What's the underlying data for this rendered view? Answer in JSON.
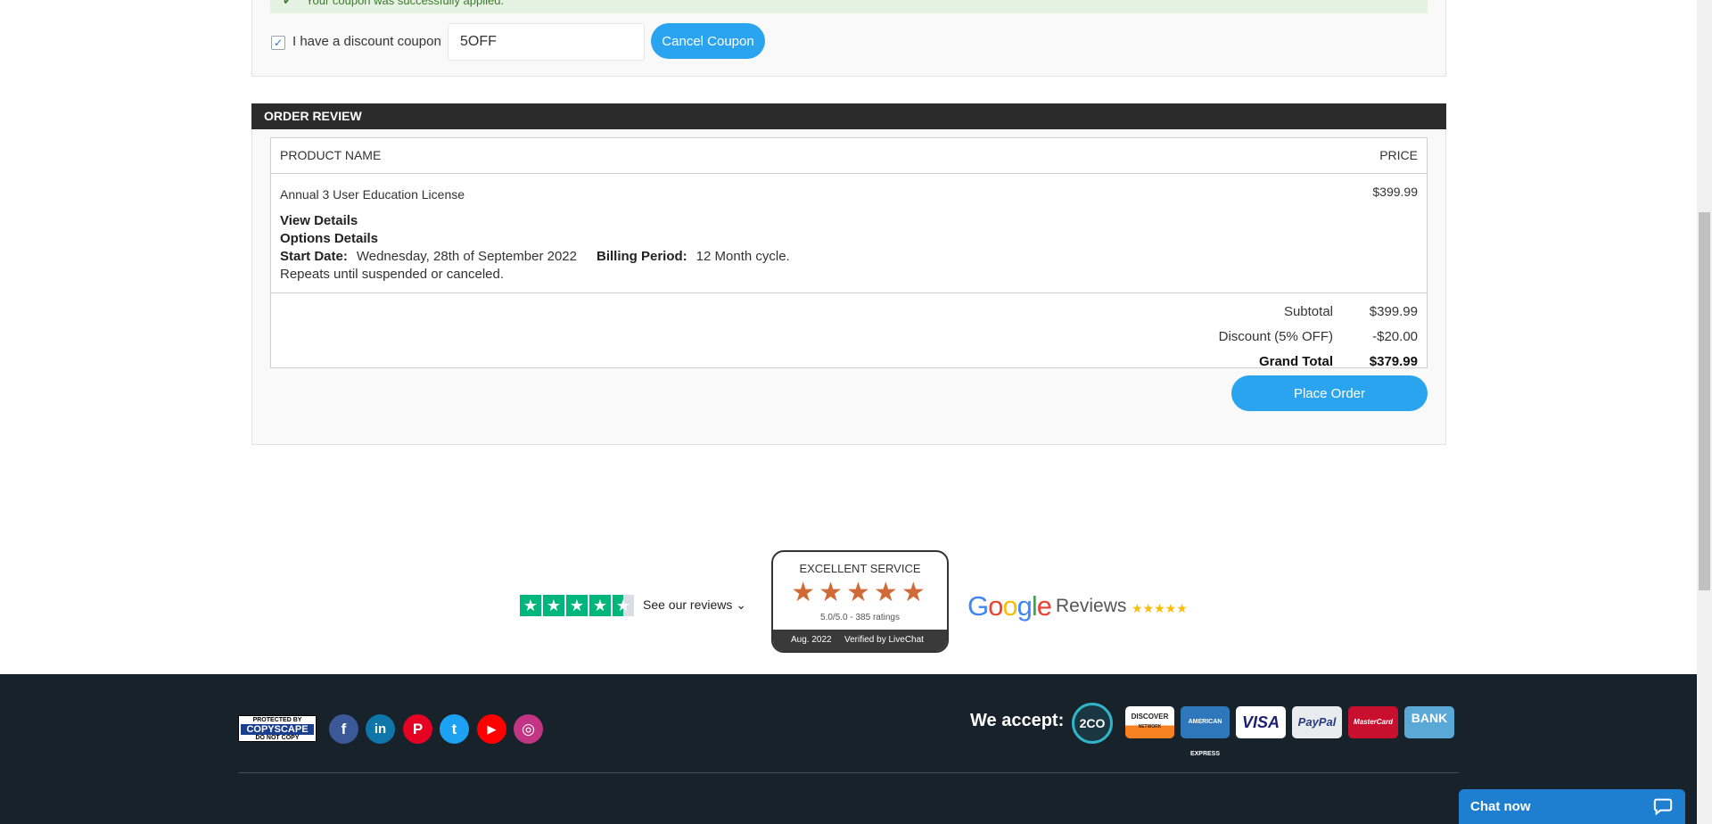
{
  "coupon": {
    "success_message": "Your coupon was successfully applied.",
    "checkbox_mark": "✓",
    "label": "I have a discount coupon",
    "code_value": "5OFF",
    "cancel_label": "Cancel Coupon"
  },
  "order_review": {
    "title": "ORDER REVIEW",
    "columns": {
      "name": "PRODUCT NAME",
      "price": "PRICE"
    },
    "product": {
      "name": "Annual 3 User Education License",
      "price": "$399.99",
      "view_details": "View Details",
      "options_details": "Options Details",
      "start_date_label": "Start Date:",
      "start_date_value": "Wednesday, 28th of September 2022",
      "billing_period_label": "Billing Period:",
      "billing_period_value": "12 Month cycle.",
      "repeats": "Repeats until suspended or canceled."
    },
    "totals": {
      "subtotal_label": "Subtotal",
      "subtotal_value": "$399.99",
      "discount_label": "Discount (5% OFF)",
      "discount_value": "-$20.00",
      "grand_label": "Grand Total",
      "grand_value": "$379.99"
    },
    "place_order_label": "Place Order"
  },
  "reviews": {
    "trustpilot_link": "See our reviews",
    "trustpilot_chevron": "⌄",
    "livechat": {
      "title": "EXCELLENT SERVICE",
      "stars": "★★★★★",
      "rating": "5.0/5.0 - 385 ratings",
      "date": "Aug. 2022",
      "verified": "Verified by LiveChat"
    },
    "google": {
      "reviews_label": "Reviews",
      "stars": "★★★★★"
    }
  },
  "footer": {
    "copyscape": {
      "line1": "PROTECTED BY",
      "line2": "COPYSCAPE",
      "line3": "DO NOT COPY"
    },
    "social": [
      {
        "name": "facebook",
        "glyph": "f",
        "color": "#3b5998"
      },
      {
        "name": "linkedin",
        "glyph": "in",
        "color": "#0e76a8"
      },
      {
        "name": "pinterest",
        "glyph": "P",
        "color": "#e60023"
      },
      {
        "name": "twitter",
        "glyph": "t",
        "color": "#1da1f2"
      },
      {
        "name": "youtube",
        "glyph": "▶",
        "color": "#ff0000"
      },
      {
        "name": "instagram",
        "glyph": "◎",
        "color": "#c13584"
      }
    ],
    "accept_label": "We accept:",
    "payments": {
      "twoco": "2CO",
      "discover": "DISCOVER",
      "discover_sub": "NETWORK",
      "amex": "AMERICAN EXPRESS",
      "visa": "VISA",
      "paypal": "PayPal",
      "mastercard": "MasterCard",
      "bank": "BANK"
    }
  },
  "chat": {
    "label": "Chat now"
  },
  "colors": {
    "accent": "#2aa4ee",
    "footer_bg": "#18222b",
    "trustpilot": "#00b67a",
    "livechat_star": "#d06a36",
    "chat": "#1e7fd1"
  }
}
